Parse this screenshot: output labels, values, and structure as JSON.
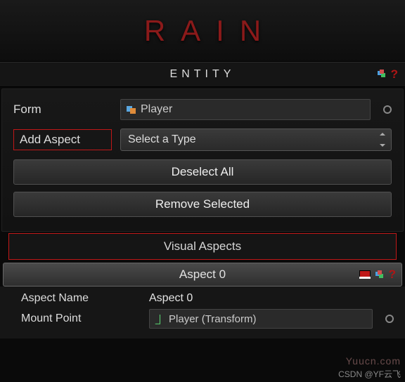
{
  "banner": {
    "title": "RAIN"
  },
  "section": {
    "title": "ENTITY"
  },
  "form": {
    "label": "Form",
    "value": "Player"
  },
  "addAspect": {
    "label": "Add Aspect",
    "selectValue": "Select a Type"
  },
  "buttons": {
    "deselect": "Deselect All",
    "remove": "Remove Selected"
  },
  "visualAspects": {
    "header": "Visual Aspects",
    "item": {
      "title": "Aspect 0",
      "nameLabel": "Aspect Name",
      "nameValue": "Aspect 0",
      "mountLabel": "Mount Point",
      "mountValue": "Player (Transform)"
    }
  },
  "watermark": "Yuucn.com",
  "credit": "CSDN @YF云飞"
}
